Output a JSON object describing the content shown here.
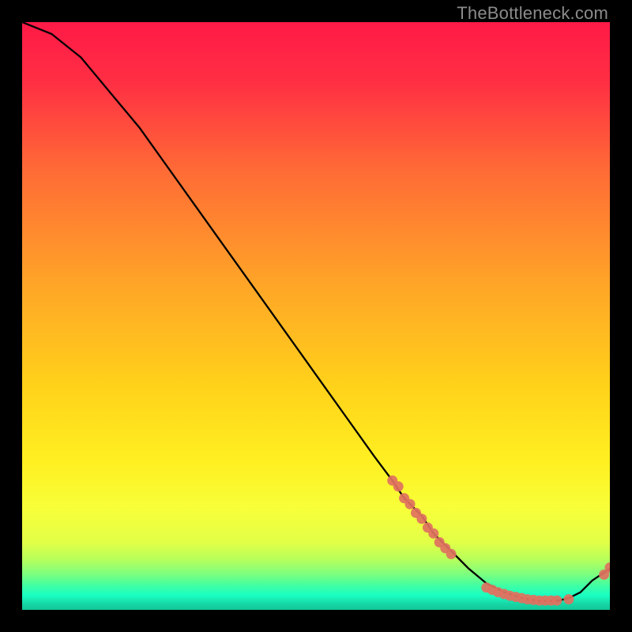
{
  "watermark": "TheBottleneck.com",
  "chart_data": {
    "type": "line",
    "title": "",
    "xlabel": "",
    "ylabel": "",
    "xlim": [
      0,
      100
    ],
    "ylim": [
      0,
      100
    ],
    "grid": false,
    "legend": false,
    "series": [
      {
        "name": "curve",
        "x": [
          0,
          5,
          10,
          15,
          20,
          25,
          30,
          35,
          40,
          45,
          50,
          55,
          60,
          63,
          65,
          68,
          70,
          72,
          74,
          76,
          79,
          82,
          85,
          88,
          91,
          93,
          95,
          97,
          100
        ],
        "y": [
          100,
          98,
          94,
          88,
          82,
          75,
          68,
          61,
          54,
          47,
          40,
          33,
          26,
          22,
          19,
          16,
          13,
          11,
          9,
          7,
          4.5,
          3,
          2,
          1.5,
          1.5,
          2,
          3,
          5,
          7
        ]
      },
      {
        "name": "dots-descent-cluster",
        "x": [
          63,
          64,
          65,
          66,
          67,
          68,
          69,
          70,
          71,
          72,
          73
        ],
        "y": [
          22,
          21,
          19,
          18,
          16.5,
          15.5,
          14,
          13,
          11.5,
          10.5,
          9.5
        ]
      },
      {
        "name": "dots-valley-cluster",
        "x": [
          79,
          80,
          81,
          82,
          83,
          84,
          85,
          86,
          87,
          88,
          89,
          90,
          91,
          93
        ],
        "y": [
          3.8,
          3.4,
          3.0,
          2.7,
          2.4,
          2.2,
          2.0,
          1.8,
          1.7,
          1.6,
          1.6,
          1.6,
          1.6,
          1.8
        ]
      },
      {
        "name": "dots-tail",
        "x": [
          99,
          100
        ],
        "y": [
          6.0,
          7.2
        ]
      }
    ],
    "background_gradient": {
      "top_color": "#ff1a47",
      "mid_color": "#ffd21a",
      "lower_band_colors": [
        "#f7ff4d",
        "#d6ff4d",
        "#9cff6e",
        "#4dffad",
        "#1affc2",
        "#17e2b0",
        "#15cf9e"
      ]
    }
  }
}
